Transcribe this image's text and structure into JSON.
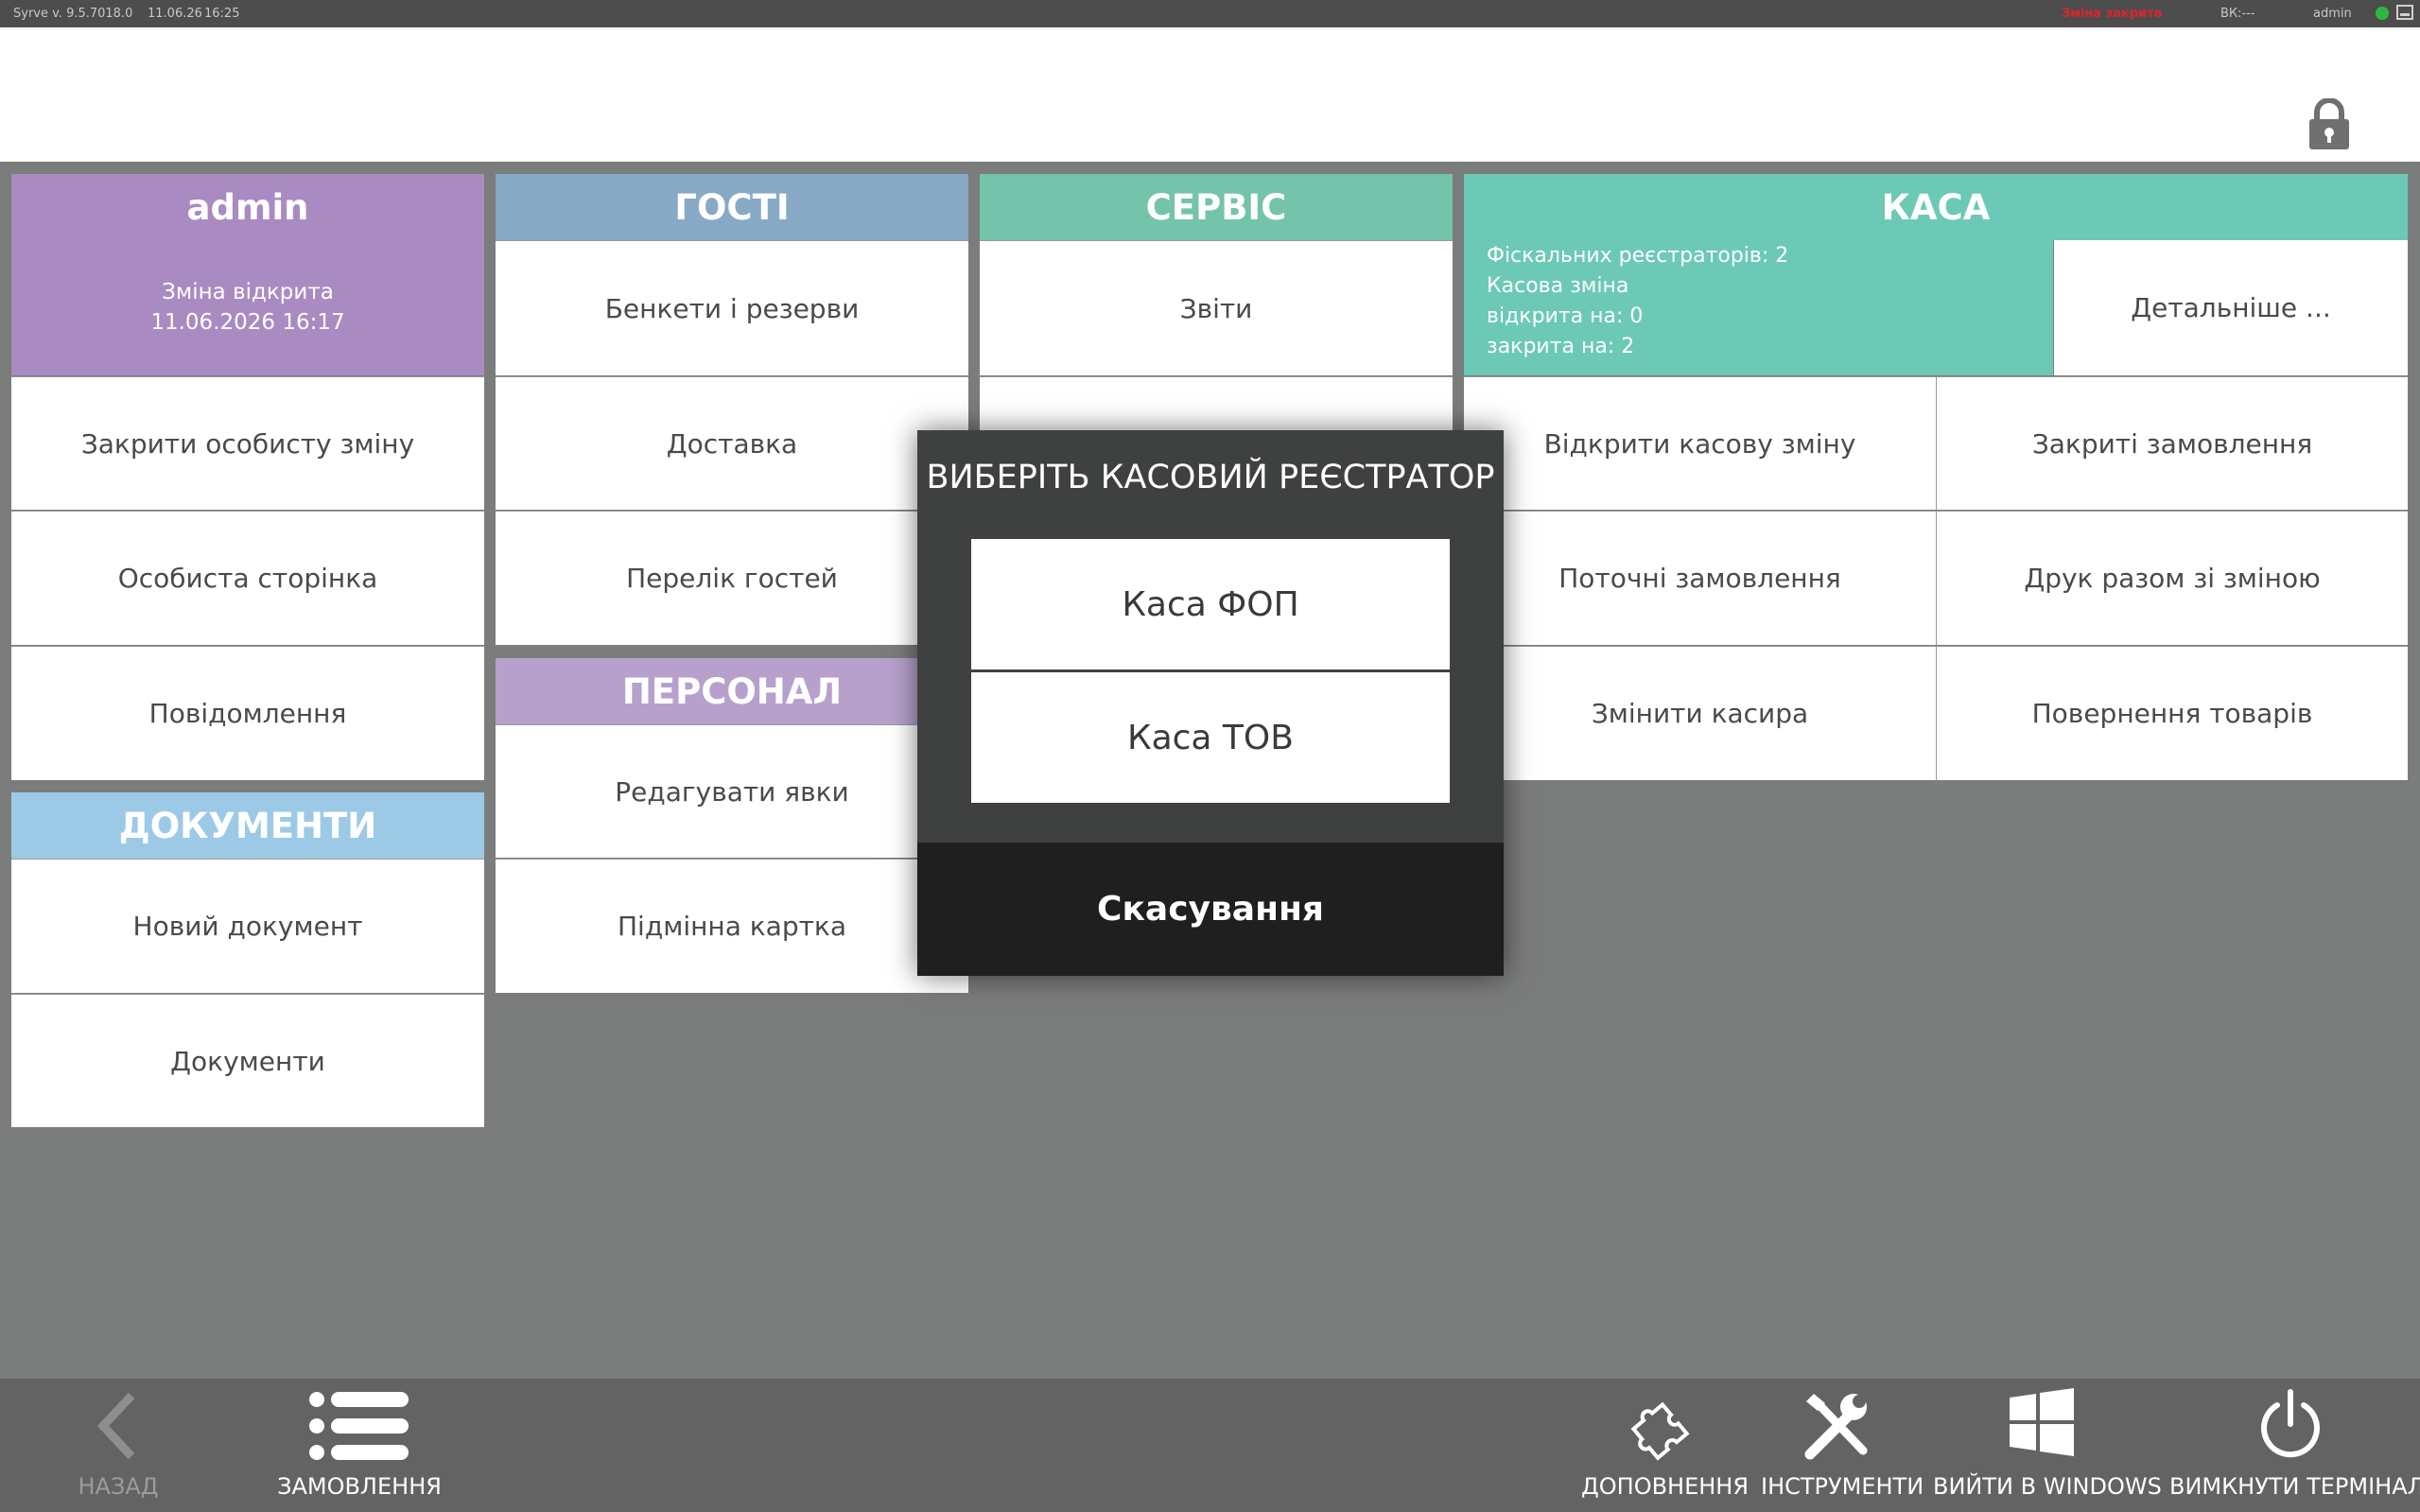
{
  "topbar": {
    "version": "Syrve  v. 9.5.7018.0",
    "date": "11.06.26",
    "time": "16:25",
    "shift_status": "Зміна закрита",
    "bk": "ВК:---",
    "user": "admin"
  },
  "colors": {
    "user": "#a98bc1",
    "guests": "#87a9c6",
    "service": "#74c3ab",
    "staff": "#b7a1cc",
    "documents": "#9ccae6",
    "kasa": "#6cc9b6",
    "shift_closed": "#e0232a"
  },
  "user_panel": {
    "name": "admin",
    "shift_line1": "Зміна відкрита",
    "shift_line2": "11.06.2026 16:17",
    "items": [
      "Закрити особисту зміну",
      "Особиста сторінка",
      "Повідомлення"
    ]
  },
  "documents_panel": {
    "title": "ДОКУМЕНТИ",
    "items": [
      "Новий документ",
      "Документи"
    ]
  },
  "guests_panel": {
    "title": "ГОСТІ",
    "items": [
      "Бенкети і резерви",
      "Доставка",
      "Перелік гостей"
    ]
  },
  "staff_panel": {
    "title": "ПЕРСОНАЛ",
    "items": [
      "Редагувати явки",
      "Підмінна картка"
    ]
  },
  "service_panel": {
    "title": "СЕРВІС",
    "items": [
      "Звіти"
    ]
  },
  "kasa_panel": {
    "title": "КАСА",
    "fiscal": "Фіскальних реєстраторів: 2",
    "shift": "Касова зміна",
    "opened": "відкрита на: 0",
    "closed": "закрита на: 2",
    "details": "Детальніше ...",
    "items": [
      "Відкрити касову зміну",
      "Закриті замовлення",
      "Поточні замовлення",
      "Друк разом зі зміною",
      "Змінити касира",
      "Повернення товарів"
    ]
  },
  "dialog": {
    "title": "ВИБЕРІТЬ КАСОВИЙ РЕЄСТРАТОР",
    "options": [
      "Каса ФОП",
      "Каса ТОВ"
    ],
    "cancel": "Скасування"
  },
  "footer": {
    "back": "НАЗАД",
    "orders": "ЗАМОВЛЕННЯ",
    "addons": "ДОПОВНЕННЯ",
    "tools": "ІНСТРУМЕНТИ",
    "exit_windows": "ВИЙТИ В WINDOWS",
    "shutdown": "ВИМКНУТИ ТЕРМІНАЛ"
  },
  "icons": [
    "lock-icon",
    "chevron-left-icon",
    "list-icon",
    "puzzle-icon",
    "tools-icon",
    "windows-icon",
    "power-icon"
  ]
}
